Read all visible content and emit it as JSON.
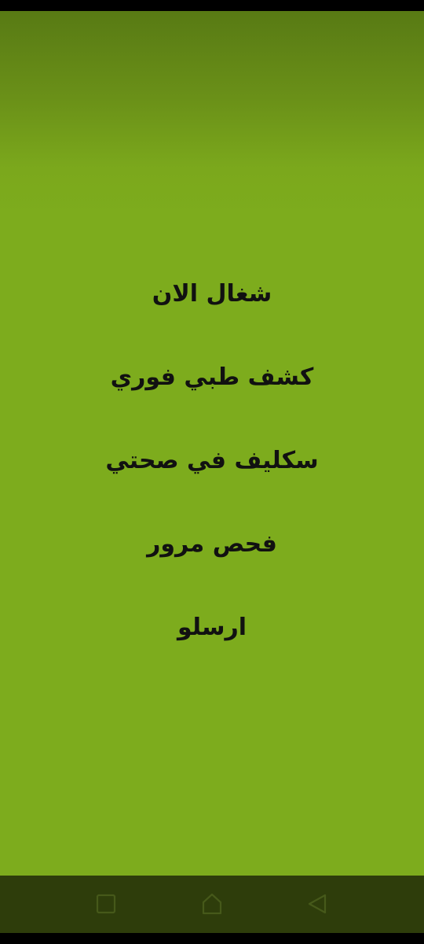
{
  "menu": {
    "items": [
      {
        "label": "شغال الان"
      },
      {
        "label": "كشف طبي فوري"
      },
      {
        "label": "سكليف في صحتي"
      },
      {
        "label": "فحص مرور"
      },
      {
        "label": "ارسلو"
      }
    ]
  },
  "navigation": {
    "buttons": [
      "recents",
      "home",
      "back"
    ]
  },
  "colors": {
    "background": "#7dac1d",
    "background_top": "#587a14",
    "nav_bar": "#2e3d0b",
    "text": "#111111",
    "nav_icon": "#46591a"
  }
}
